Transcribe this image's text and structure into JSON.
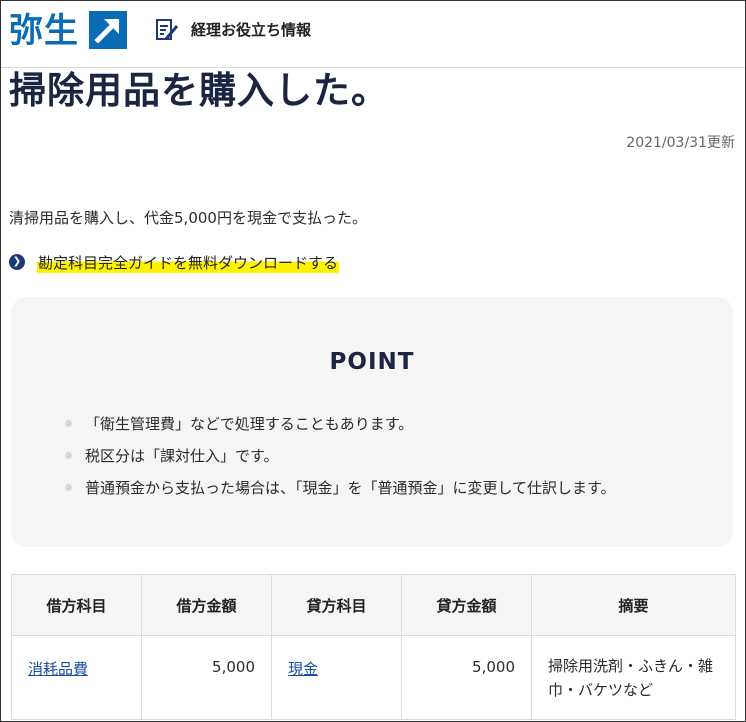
{
  "header": {
    "logo_text": "弥生",
    "nav_label": "経理お役立ち情報",
    "brand_color": "#0a6cb5"
  },
  "article": {
    "title": "掃除用品を購入した。",
    "updated": "2021/03/31更新",
    "body": "清掃用品を購入し、代金5,000円を現金で支払った。",
    "download_link": "勘定科目完全ガイドを無料ダウンロードする"
  },
  "point": {
    "title": "POINT",
    "items": [
      "「衛生管理費」などで処理することもあります。",
      "税区分は「課対仕入」です。",
      "普通預金から支払った場合は、「現金」を「普通預金」に変更して仕訳します。"
    ]
  },
  "journal": {
    "headers": [
      "借方科目",
      "借方金額",
      "貸方科目",
      "貸方金額",
      "摘要"
    ],
    "row": {
      "debit_account": "消耗品費",
      "debit_amount": "5,000",
      "credit_account": "現金",
      "credit_amount": "5,000",
      "memo": "掃除用洗剤・ふきん・雑巾・バケツなど"
    }
  }
}
